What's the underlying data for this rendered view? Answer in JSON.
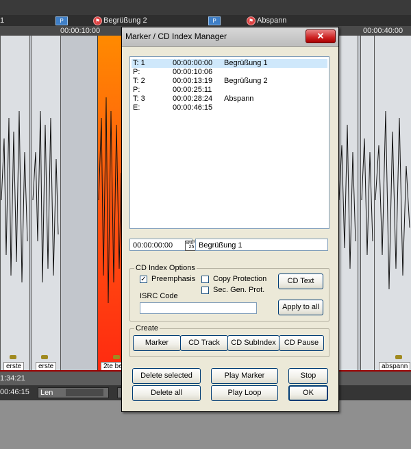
{
  "timeline": {
    "markers": [
      {
        "label": "1"
      },
      {
        "label": "P"
      },
      {
        "label": "Begrüßung 2"
      },
      {
        "label": "P"
      },
      {
        "label": "Abspann"
      }
    ],
    "ruler_ticks": [
      "00:00:10:00",
      "00:00:40:00"
    ],
    "clip_labels": [
      "erste",
      "erste",
      "2te be",
      "abspann"
    ],
    "status_time_1": "1:34:21",
    "status_time_2": "00:46:15",
    "len_label": "Len",
    "colors": {
      "selected_clip": "#ff6a00",
      "marker_p": "#3f7fc7",
      "marker_cd": "#dd4444"
    }
  },
  "dialog": {
    "title": "Marker / CD Index Manager",
    "close_icon": "close-icon",
    "list": [
      {
        "type": "T: 1",
        "time": "00:00:00:00",
        "name": "Begrüßung 1",
        "selected": true
      },
      {
        "type": "P:",
        "time": "00:00:10:06",
        "name": "",
        "selected": false
      },
      {
        "type": "T: 2",
        "time": "00:00:13:19",
        "name": "Begrüßung 2",
        "selected": false
      },
      {
        "type": "P:",
        "time": "00:00:25:11",
        "name": "",
        "selected": false
      },
      {
        "type": "T: 3",
        "time": "00:00:28:24",
        "name": "Abspann",
        "selected": false
      },
      {
        "type": "E:",
        "time": "00:00:46:15",
        "name": "",
        "selected": false
      }
    ],
    "time_field": "00:00:00:00",
    "smpte_label": "SMPTE",
    "smpte_fps": "25",
    "name_field": "Begrüßung 1",
    "cd_index_options": {
      "label": "CD Index Options",
      "preemphasis": {
        "label": "Preemphasis",
        "checked": true
      },
      "copy_protection": {
        "label": "Copy Protection",
        "checked": false
      },
      "sec_gen_prot": {
        "label": "Sec. Gen. Prot.",
        "checked": false
      },
      "cd_text_button": "CD Text",
      "isrc_label": "ISRC Code",
      "isrc_value": "",
      "apply_all_button": "Apply to all"
    },
    "create": {
      "label": "Create",
      "buttons": [
        "Marker",
        "CD Track",
        "CD SubIndex",
        "CD Pause"
      ]
    },
    "bottom_buttons": {
      "delete_selected": "Delete selected",
      "play_marker": "Play Marker",
      "stop": "Stop",
      "delete_all": "Delete all",
      "play_loop": "Play Loop",
      "ok": "OK"
    }
  }
}
